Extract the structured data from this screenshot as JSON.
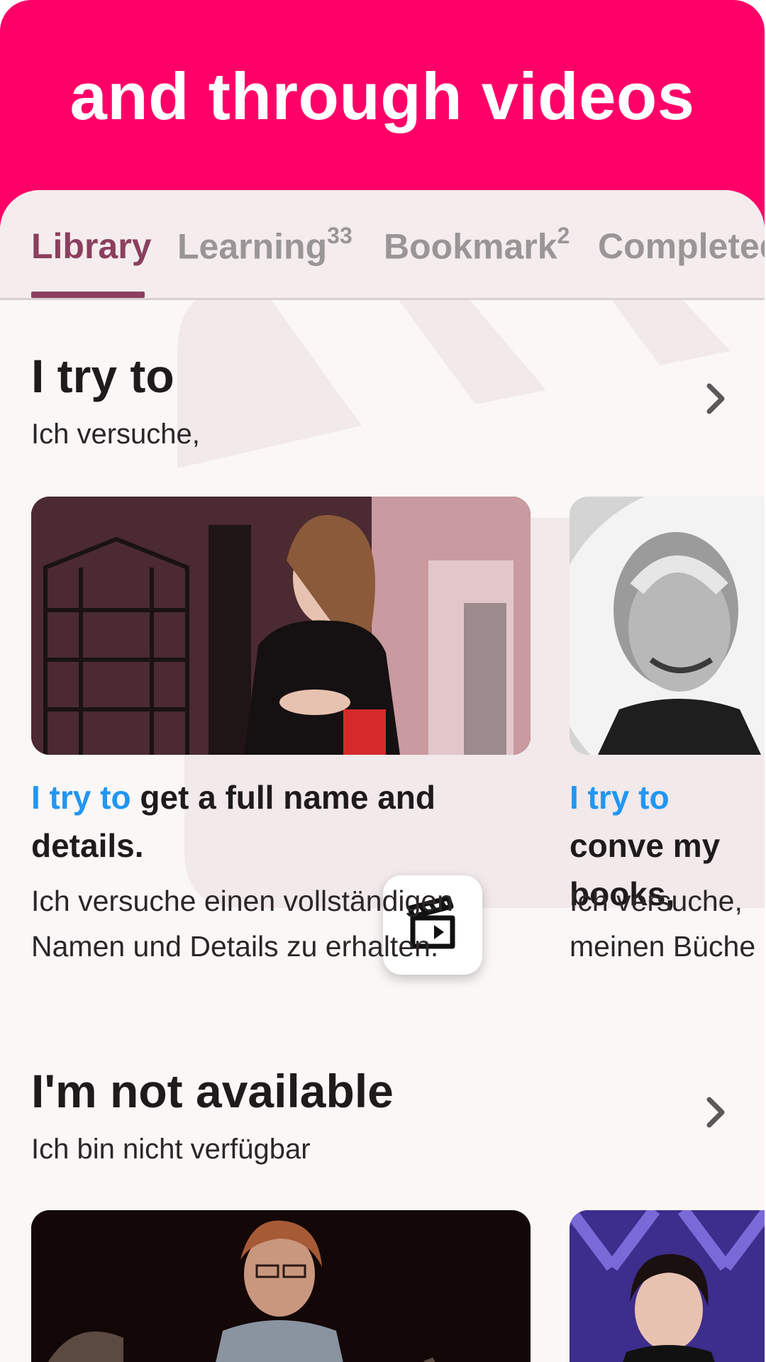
{
  "header": {
    "title": "and through videos"
  },
  "tabs": [
    {
      "label": "Library",
      "badge": ""
    },
    {
      "label": "Learning",
      "badge": "33"
    },
    {
      "label": "Bookmark",
      "badge": "2"
    },
    {
      "label": "Completed",
      "badge": ""
    }
  ],
  "sections": [
    {
      "title": "I try to",
      "subtitle": "Ich versuche,",
      "cards": [
        {
          "highlight": "I try to",
          "rest": " get a full name and details.",
          "translation": "Ich versuche einen vollständigen Namen und Details zu erhalten."
        },
        {
          "highlight": "I try to",
          "rest": " conve my books,",
          "translation": "Ich versuche, meinen Büche"
        }
      ]
    },
    {
      "title": "I'm not available",
      "subtitle": "Ich bin nicht verfügbar"
    }
  ],
  "colors": {
    "header": "#ff0068",
    "active_tab": "#8b3f5d",
    "highlight": "#2196f3"
  }
}
